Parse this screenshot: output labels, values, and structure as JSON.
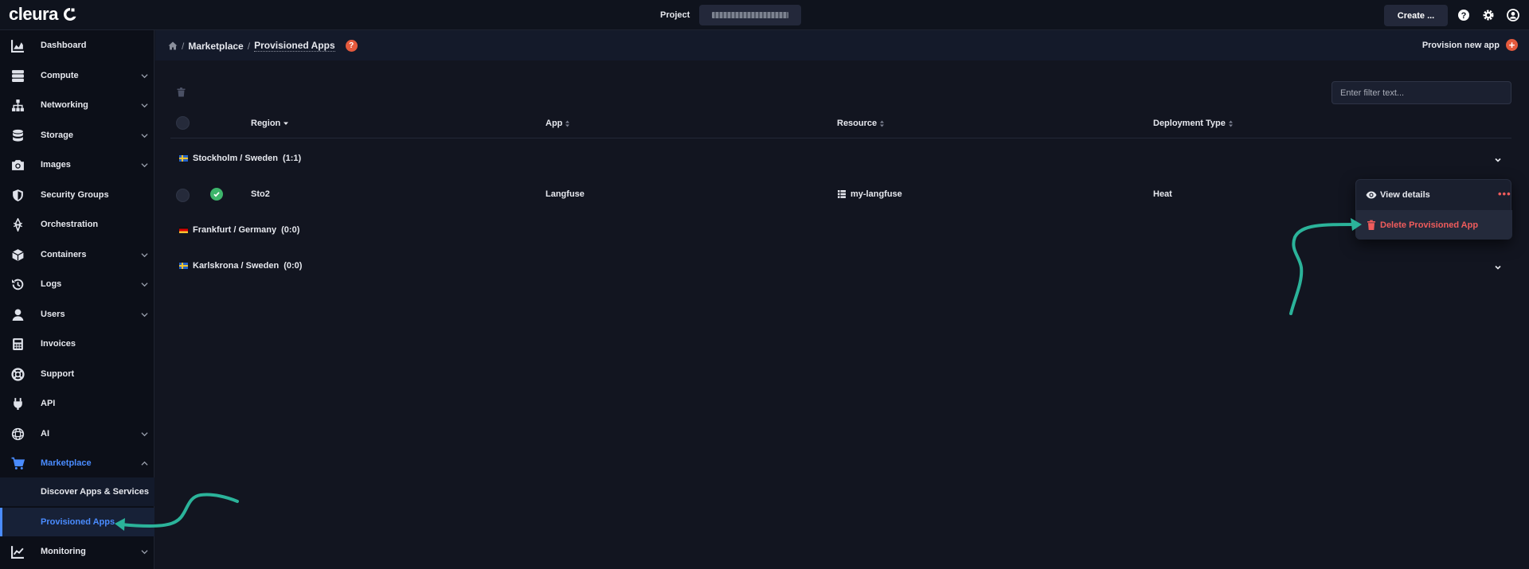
{
  "brand": {
    "name": "cleura"
  },
  "topbar": {
    "project_label": "Project",
    "create_label": "Create ..."
  },
  "sidebar": {
    "items": [
      {
        "label": "Dashboard",
        "icon": "chart-area-icon",
        "expandable": false
      },
      {
        "label": "Compute",
        "icon": "server-icon",
        "expandable": true
      },
      {
        "label": "Networking",
        "icon": "network-icon",
        "expandable": true
      },
      {
        "label": "Storage",
        "icon": "database-icon",
        "expandable": true
      },
      {
        "label": "Images",
        "icon": "camera-icon",
        "expandable": true
      },
      {
        "label": "Security Groups",
        "icon": "shield-icon",
        "expandable": false
      },
      {
        "label": "Orchestration",
        "icon": "orchestration-icon",
        "expandable": false
      },
      {
        "label": "Containers",
        "icon": "cube-icon",
        "expandable": true
      },
      {
        "label": "Logs",
        "icon": "history-icon",
        "expandable": true
      },
      {
        "label": "Users",
        "icon": "user-icon",
        "expandable": true
      },
      {
        "label": "Invoices",
        "icon": "calculator-icon",
        "expandable": false
      },
      {
        "label": "Support",
        "icon": "life-ring-icon",
        "expandable": false
      },
      {
        "label": "API",
        "icon": "plug-icon",
        "expandable": false
      },
      {
        "label": "AI",
        "icon": "ai-icon",
        "expandable": true
      },
      {
        "label": "Marketplace",
        "icon": "cart-icon",
        "expandable": true,
        "expanded": true
      }
    ],
    "marketplace_sub": [
      {
        "label": "Discover Apps & Services"
      },
      {
        "label": "Provisioned Apps",
        "current": true
      }
    ],
    "after": [
      {
        "label": "Monitoring",
        "icon": "chart-line-icon",
        "expandable": true
      }
    ]
  },
  "breadcrumb": {
    "sep": "/",
    "items": [
      "Marketplace",
      "Provisioned Apps"
    ],
    "help": "?"
  },
  "actions": {
    "provision_label": "Provision new app",
    "plus": "+"
  },
  "filter": {
    "placeholder": "Enter filter text..."
  },
  "table": {
    "columns": [
      "Region",
      "App",
      "Resource",
      "Deployment Type"
    ],
    "groups": [
      {
        "label": "Stockholm / Sweden",
        "count": "(1:1)",
        "flag": "se"
      },
      {
        "label": "Frankfurt / Germany",
        "count": "(0:0)",
        "flag": "de"
      },
      {
        "label": "Karlskrona / Sweden",
        "count": "(0:0)",
        "flag": "se"
      }
    ],
    "row": {
      "region": "Sto2",
      "app": "Langfuse",
      "resource": "my-langfuse",
      "deployment_type": "Heat",
      "status": "ok"
    }
  },
  "dropdown": {
    "view_details": "View details",
    "delete": "Delete Provisioned App",
    "more": "•••"
  },
  "colors": {
    "accent": "#4a8cff",
    "danger": "#f05c5c",
    "brand_orange": "#e45a3d",
    "annotation": "#2bb39a"
  }
}
